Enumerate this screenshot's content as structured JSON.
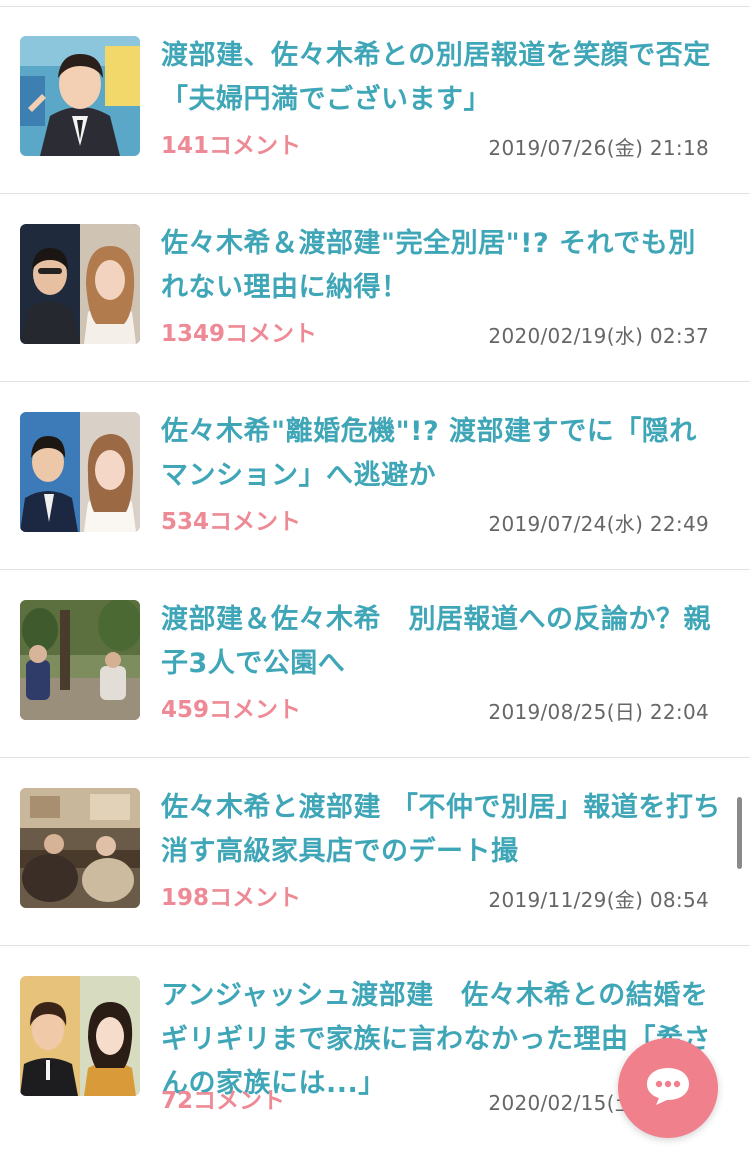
{
  "articles": [
    {
      "title": "渡部建、佐々木希との別居報道を笑顔で否定「夫婦円満でございます」",
      "comments": "141コメント",
      "date": "2019/07/26(金) 21:18"
    },
    {
      "title": "佐々木希＆渡部建\"完全別居\"!? それでも別れない理由に納得！",
      "comments": "1349コメント",
      "date": "2020/02/19(水) 02:37"
    },
    {
      "title": "佐々木希\"離婚危機\"!? 渡部建すでに「隠れマンション」へ逃避か",
      "comments": "534コメント",
      "date": "2019/07/24(水) 22:49"
    },
    {
      "title": "渡部建＆佐々木希　別居報道への反論か？親子3人で公園へ",
      "comments": "459コメント",
      "date": "2019/08/25(日) 22:04"
    },
    {
      "title": "佐々木希と渡部建 「不仲で別居」報道を打ち消す高級家具店でのデート撮",
      "comments": "198コメント",
      "date": "2019/11/29(金) 08:54"
    },
    {
      "title": "アンジャッシュ渡部建　佐々木希との結婚をギリギリまで家族に言わなかった理由「希さんの家族には...」",
      "comments": "72コメント",
      "date": "2020/02/15(土) 17:11"
    }
  ],
  "colors": {
    "title": "#3fa6b8",
    "comments": "#ee8a96",
    "date": "#666666",
    "chat_button": "#f0808c"
  },
  "icons": {
    "chat_button": "chat-bubble-icon"
  }
}
